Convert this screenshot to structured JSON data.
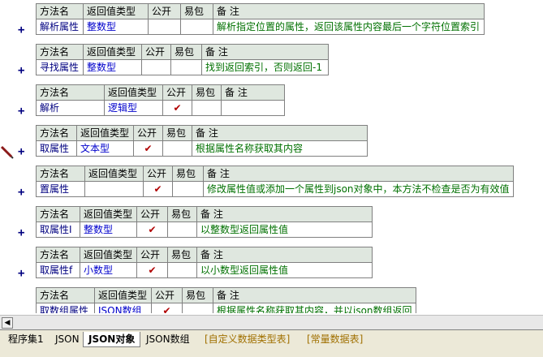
{
  "headers": {
    "name": "方法名",
    "rtype": "返回值类型",
    "pub": "公开",
    "easy": "易包",
    "remark": "备 注"
  },
  "methods": [
    {
      "name": "解析属性",
      "rtype": "整数型",
      "pub": "",
      "remark": "解析指定位置的属性，返回该属性内容最后一个字符位置索引"
    },
    {
      "name": "寻找属性",
      "rtype": "整数型",
      "pub": "",
      "remark": "找到返回索引，否则返回-1"
    },
    {
      "name": "解析",
      "rtype": "逻辑型",
      "pub": "✔",
      "remark": ""
    },
    {
      "name": "取属性",
      "rtype": "文本型",
      "pub": "✔",
      "remark": "根据属性名称获取其内容"
    },
    {
      "name": "置属性",
      "rtype": "",
      "pub": "✔",
      "remark": "修改属性值或添加一个属性到json对象中，本方法不检查是否为有效值"
    },
    {
      "name": "取属性I",
      "rtype": "整数型",
      "pub": "✔",
      "remark": "以整数型返回属性值"
    },
    {
      "name": "取属性f",
      "rtype": "小数型",
      "pub": "✔",
      "remark": "以小数型返回属性值"
    },
    {
      "name": "取数组属性",
      "rtype": "JSON数组",
      "pub": "✔",
      "remark": "根据属性名称获取其内容，并以json数组返回"
    }
  ],
  "expand_symbol": "+",
  "tabs": [
    "程序集1",
    "JSON",
    "JSON对象",
    "JSON数组",
    "[自定义数据类型表]",
    "[常量数据表]"
  ],
  "active_tab": "JSON对象",
  "colors": {
    "header_bg": "#dfe7df",
    "check": "#b00000",
    "remark": "#007000",
    "type": "#0000cc"
  }
}
